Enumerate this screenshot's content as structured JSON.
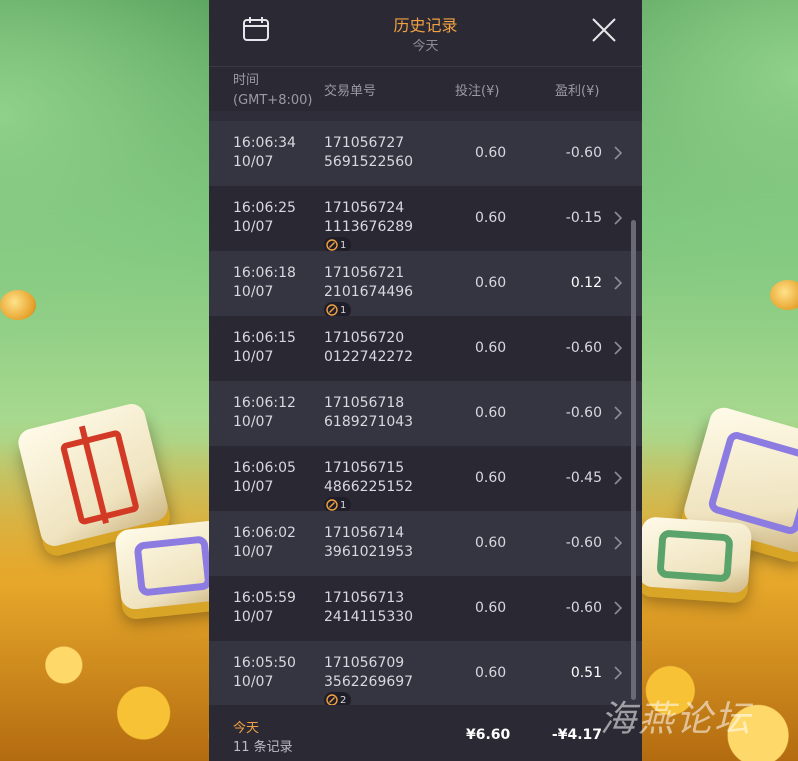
{
  "header": {
    "title": "历史记录",
    "subtitle": "今天"
  },
  "columns": {
    "time_line1": "时间",
    "time_line2": "(GMT+8:00)",
    "order": "交易单号",
    "bet": "投注(¥)",
    "profit": "盈利(¥)"
  },
  "rows": [
    {
      "time": "16:06:34",
      "date": "10/07",
      "order1": "171056727",
      "order2": "5691522560",
      "bet": "0.60",
      "profit": "-0.60",
      "badge": ""
    },
    {
      "time": "16:06:25",
      "date": "10/07",
      "order1": "171056724",
      "order2": "1113676289",
      "bet": "0.60",
      "profit": "-0.15",
      "badge": "1"
    },
    {
      "time": "16:06:18",
      "date": "10/07",
      "order1": "171056721",
      "order2": "2101674496",
      "bet": "0.60",
      "profit": "0.12",
      "badge": "1"
    },
    {
      "time": "16:06:15",
      "date": "10/07",
      "order1": "171056720",
      "order2": "0122742272",
      "bet": "0.60",
      "profit": "-0.60",
      "badge": ""
    },
    {
      "time": "16:06:12",
      "date": "10/07",
      "order1": "171056718",
      "order2": "6189271043",
      "bet": "0.60",
      "profit": "-0.60",
      "badge": ""
    },
    {
      "time": "16:06:05",
      "date": "10/07",
      "order1": "171056715",
      "order2": "4866225152",
      "bet": "0.60",
      "profit": "-0.45",
      "badge": "1"
    },
    {
      "time": "16:06:02",
      "date": "10/07",
      "order1": "171056714",
      "order2": "3961021953",
      "bet": "0.60",
      "profit": "-0.60",
      "badge": ""
    },
    {
      "time": "16:05:59",
      "date": "10/07",
      "order1": "171056713",
      "order2": "2414115330",
      "bet": "0.60",
      "profit": "-0.60",
      "badge": ""
    },
    {
      "time": "16:05:50",
      "date": "10/07",
      "order1": "171056709",
      "order2": "3562269697",
      "bet": "0.60",
      "profit": "0.51",
      "badge": "2"
    }
  ],
  "footer": {
    "label": "今天",
    "count": "11 条记录",
    "total_bet": "¥6.60",
    "total_profit": "-¥4.17"
  },
  "watermark": "海燕论坛",
  "colors": {
    "accent": "#f1a143",
    "panel_bg": "#2b2a36"
  },
  "icons": {
    "calendar": "calendar-icon",
    "close": "close-icon",
    "chevron": "chevron-right-icon",
    "free_spin": "free-spin-icon"
  }
}
